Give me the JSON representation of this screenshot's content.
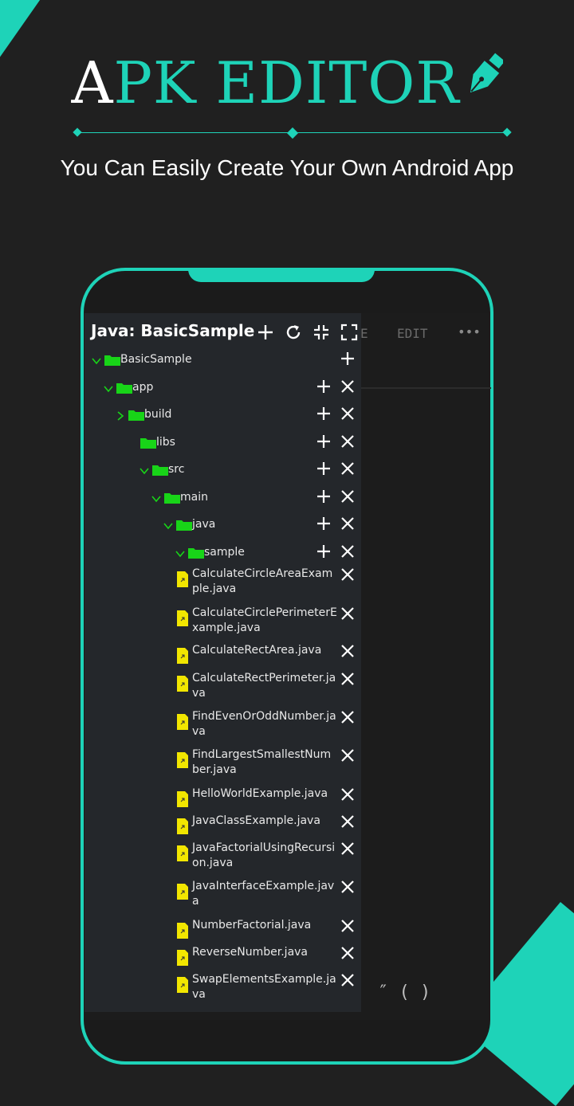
{
  "brand": {
    "title_first": "A",
    "title_rest": "PK EDITOR",
    "subtitle": "You Can Easily Create Your Own Android App",
    "accent_color": "#1ed3b8"
  },
  "editor": {
    "menu_partial": "E",
    "menu_edit": "EDIT",
    "menu_more": "•••",
    "bottom_keys": "″  (  )"
  },
  "panel": {
    "title": "Java: BasicSample",
    "header_icons": [
      "plus-icon",
      "refresh-icon",
      "collapse-icon",
      "expand-icon"
    ],
    "folders": [
      {
        "label": "BasicSample",
        "chevron": "down"
      },
      {
        "label": "app",
        "chevron": "down"
      },
      {
        "label": "build",
        "chevron": "right"
      },
      {
        "label": "libs",
        "chevron": "none"
      },
      {
        "label": "src",
        "chevron": "down"
      },
      {
        "label": "main",
        "chevron": "down"
      },
      {
        "label": "java",
        "chevron": "down"
      },
      {
        "label": "sample",
        "chevron": "down"
      }
    ],
    "files": [
      {
        "label": "CalculateCircleAreaExample.java"
      },
      {
        "label": "CalculateCirclePerimeterExample.java"
      },
      {
        "label": "CalculateRectArea.java"
      },
      {
        "label": "CalculateRectPerimeter.java"
      },
      {
        "label": "FindEvenOrOddNumber.java"
      },
      {
        "label": "FindLargestSmallestNumber.java"
      },
      {
        "label": "HelloWorldExample.java"
      },
      {
        "label": "JavaClassExample.java"
      },
      {
        "label": "JavaFactorialUsingRecursion.java"
      },
      {
        "label": "JavaInterfaceExample.java"
      },
      {
        "label": "NumberFactorial.java"
      },
      {
        "label": "ReverseNumber.java"
      },
      {
        "label": "SwapElementsExample.java"
      }
    ],
    "folder_color": "#18d418",
    "file_color": "#f2e600"
  }
}
